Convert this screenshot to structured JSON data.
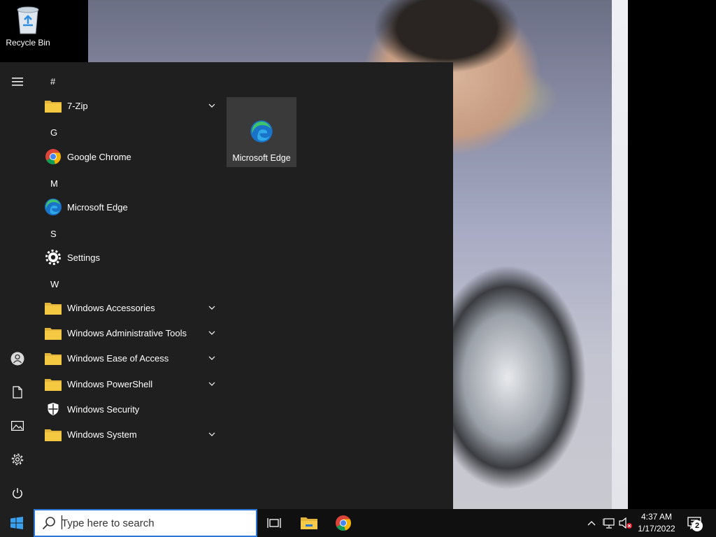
{
  "desktop": {
    "recycle_bin_label": "Recycle Bin"
  },
  "start_menu": {
    "groups": {
      "hash": "#",
      "g": "G",
      "m": "M",
      "s": "S",
      "w": "W"
    },
    "apps": {
      "seven_zip": "7-Zip",
      "chrome": "Google Chrome",
      "edge": "Microsoft Edge",
      "settings": "Settings",
      "accessories": "Windows Accessories",
      "admin_tools": "Windows Administrative Tools",
      "ease_of_access": "Windows Ease of Access",
      "powershell": "Windows PowerShell",
      "security": "Windows Security",
      "system": "Windows System"
    },
    "tiles": {
      "edge_tile_label": "Microsoft Edge"
    },
    "colors": {
      "background": "#1f1f1f",
      "tile": "#3a3a3a",
      "folder": "#f5c842"
    }
  },
  "taskbar": {
    "search_placeholder": "Type here to search",
    "clock_time": "4:37 AM",
    "clock_date": "1/17/2022",
    "notification_count": "2",
    "accent": "#2b78d6"
  }
}
